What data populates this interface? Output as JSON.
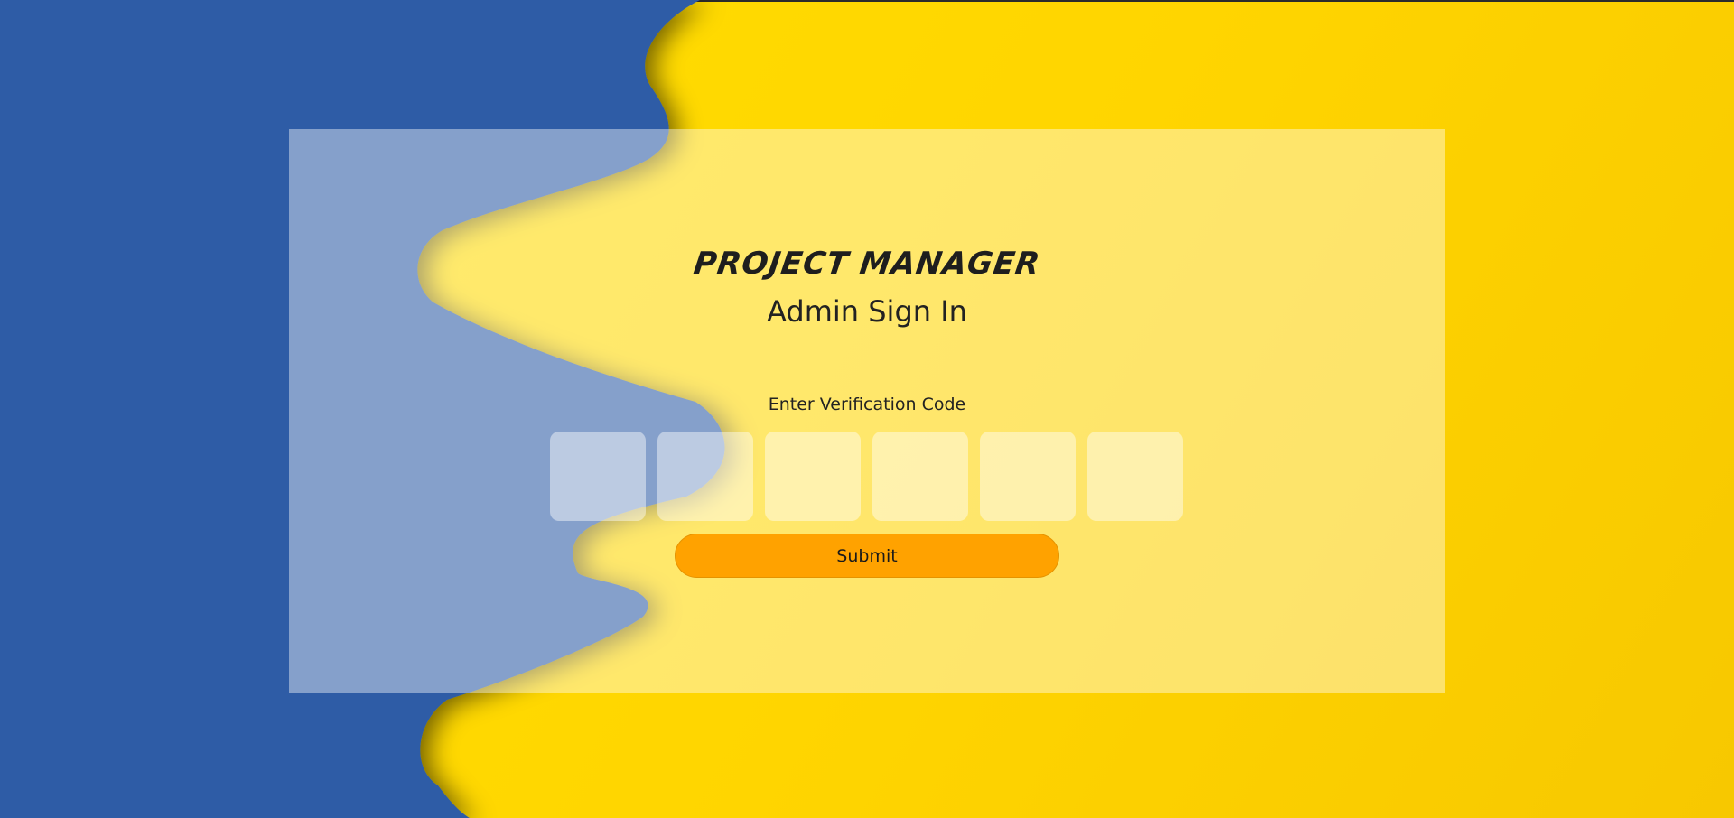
{
  "brand": {
    "title": "PROJECT MANAGER"
  },
  "signin": {
    "subtitle": "Admin Sign In",
    "code_label": "Enter Verification Code",
    "code_digits": [
      "",
      "",
      "",
      "",
      "",
      ""
    ],
    "submit_label": "Submit"
  },
  "colors": {
    "background_yellow": "#ffd800",
    "background_blue": "#2f5ba6",
    "button_orange": "#ffa200",
    "text_dark": "#222222"
  }
}
